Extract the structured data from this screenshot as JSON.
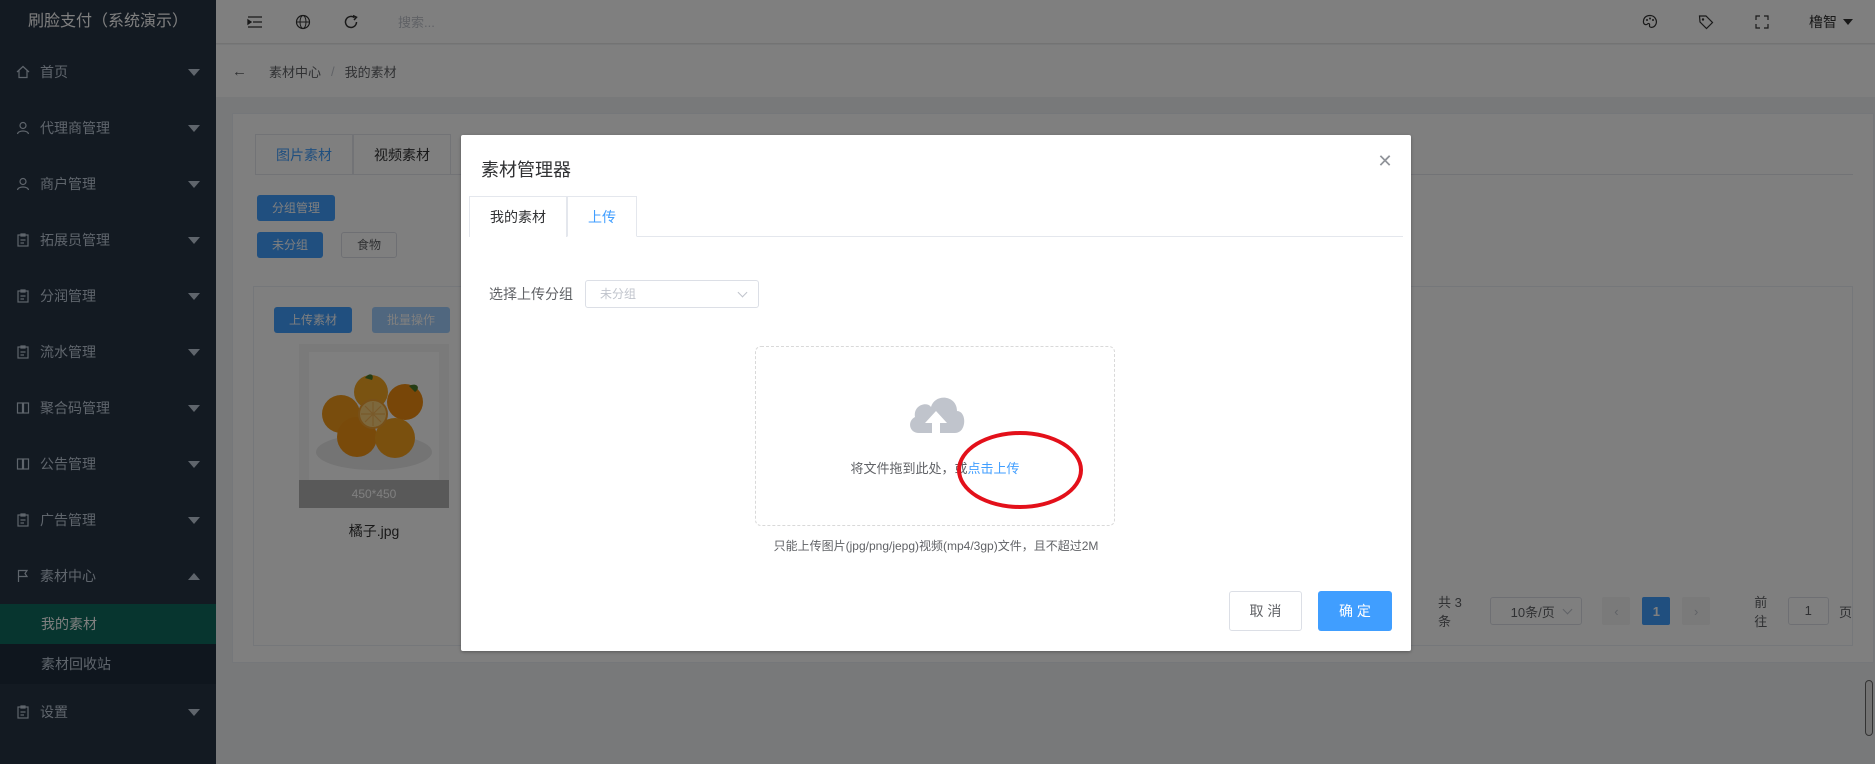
{
  "app": {
    "title": "刷脸支付（系统演示）"
  },
  "sidebar": {
    "items": [
      {
        "label": "首页",
        "icon": "home-icon"
      },
      {
        "label": "代理商管理",
        "icon": "user-icon"
      },
      {
        "label": "商户管理",
        "icon": "user-icon"
      },
      {
        "label": "拓展员管理",
        "icon": "clipboard-icon"
      },
      {
        "label": "分润管理",
        "icon": "clipboard-icon"
      },
      {
        "label": "流水管理",
        "icon": "clipboard-icon"
      },
      {
        "label": "聚合码管理",
        "icon": "document-icon"
      },
      {
        "label": "公告管理",
        "icon": "document-icon"
      },
      {
        "label": "广告管理",
        "icon": "clipboard-icon"
      },
      {
        "label": "素材中心",
        "icon": "flag-icon"
      }
    ],
    "sub_items": [
      {
        "label": "我的素材",
        "active": true
      },
      {
        "label": "素材回收站",
        "active": false
      }
    ],
    "settings": {
      "label": "设置",
      "icon": "clipboard-icon"
    }
  },
  "topbar": {
    "search_placeholder": "搜索...",
    "user_name": "橹智"
  },
  "breadcrumb": {
    "items": [
      "素材中心",
      "我的素材"
    ]
  },
  "page": {
    "tabs": [
      "图片素材",
      "视频素材"
    ],
    "group_manage_label": "分组管理",
    "groups": [
      "未分组",
      "食物"
    ],
    "upload_label": "上传素材",
    "batch_label": "批量操作",
    "item": {
      "dim": "450*450",
      "name": "橘子.jpg"
    },
    "pager": {
      "total": "共 3 条",
      "page_size": "10条/页",
      "current": "1",
      "goto_prefix": "前往",
      "goto_value": "1",
      "goto_suffix": "页"
    }
  },
  "dialog": {
    "title": "素材管理器",
    "tabs": [
      "我的素材",
      "上传"
    ],
    "group_label": "选择上传分组",
    "group_placeholder": "未分组",
    "drop_text": "将文件拖到此处，或",
    "drop_link": "点击上传",
    "tip": "只能上传图片(jpg/png/jepg)视频(mp4/3gp)文件，且不超过2M",
    "cancel_label": "取 消",
    "ok_label": "确 定"
  },
  "colors": {
    "primary": "#409eff",
    "sidebar_bg": "#263445",
    "active_sub": "#0e6b5e",
    "highlight_ring": "#e3101a"
  }
}
